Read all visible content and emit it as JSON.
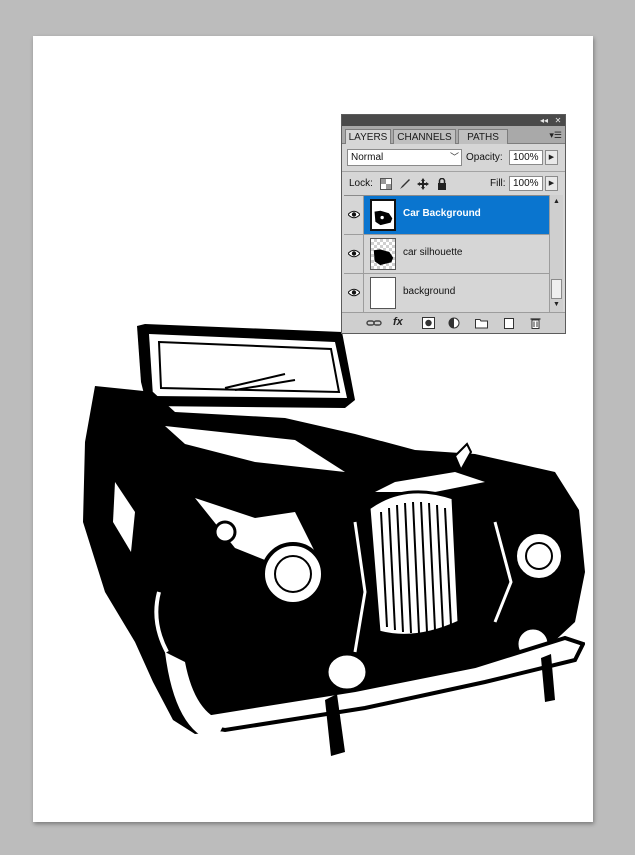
{
  "layers_panel": {
    "tabs": [
      {
        "label": "LAYERS",
        "active": true
      },
      {
        "label": "CHANNELS",
        "active": false
      },
      {
        "label": "PATHS",
        "active": false
      }
    ],
    "blend_mode": "Normal",
    "opacity_label": "Opacity:",
    "opacity_value": "100%",
    "lock_label": "Lock:",
    "fill_label": "Fill:",
    "fill_value": "100%",
    "layers": [
      {
        "name": "Car Background",
        "visible": true,
        "selected": true,
        "thumb": "car-art"
      },
      {
        "name": "car silhouette",
        "visible": true,
        "selected": false,
        "thumb": "car-on-transparent"
      },
      {
        "name": "background",
        "visible": true,
        "selected": false,
        "thumb": "white"
      }
    ],
    "footer_icons": [
      "link-layers-icon",
      "fx-icon",
      "layer-mask-icon",
      "adjustment-layer-icon",
      "new-group-icon",
      "new-layer-icon",
      "trash-icon"
    ],
    "fx_text": "fx"
  },
  "colors": {
    "selection": "#0a75cf",
    "workspace": "#bcbcbc",
    "panel": "#d6d6d6"
  }
}
